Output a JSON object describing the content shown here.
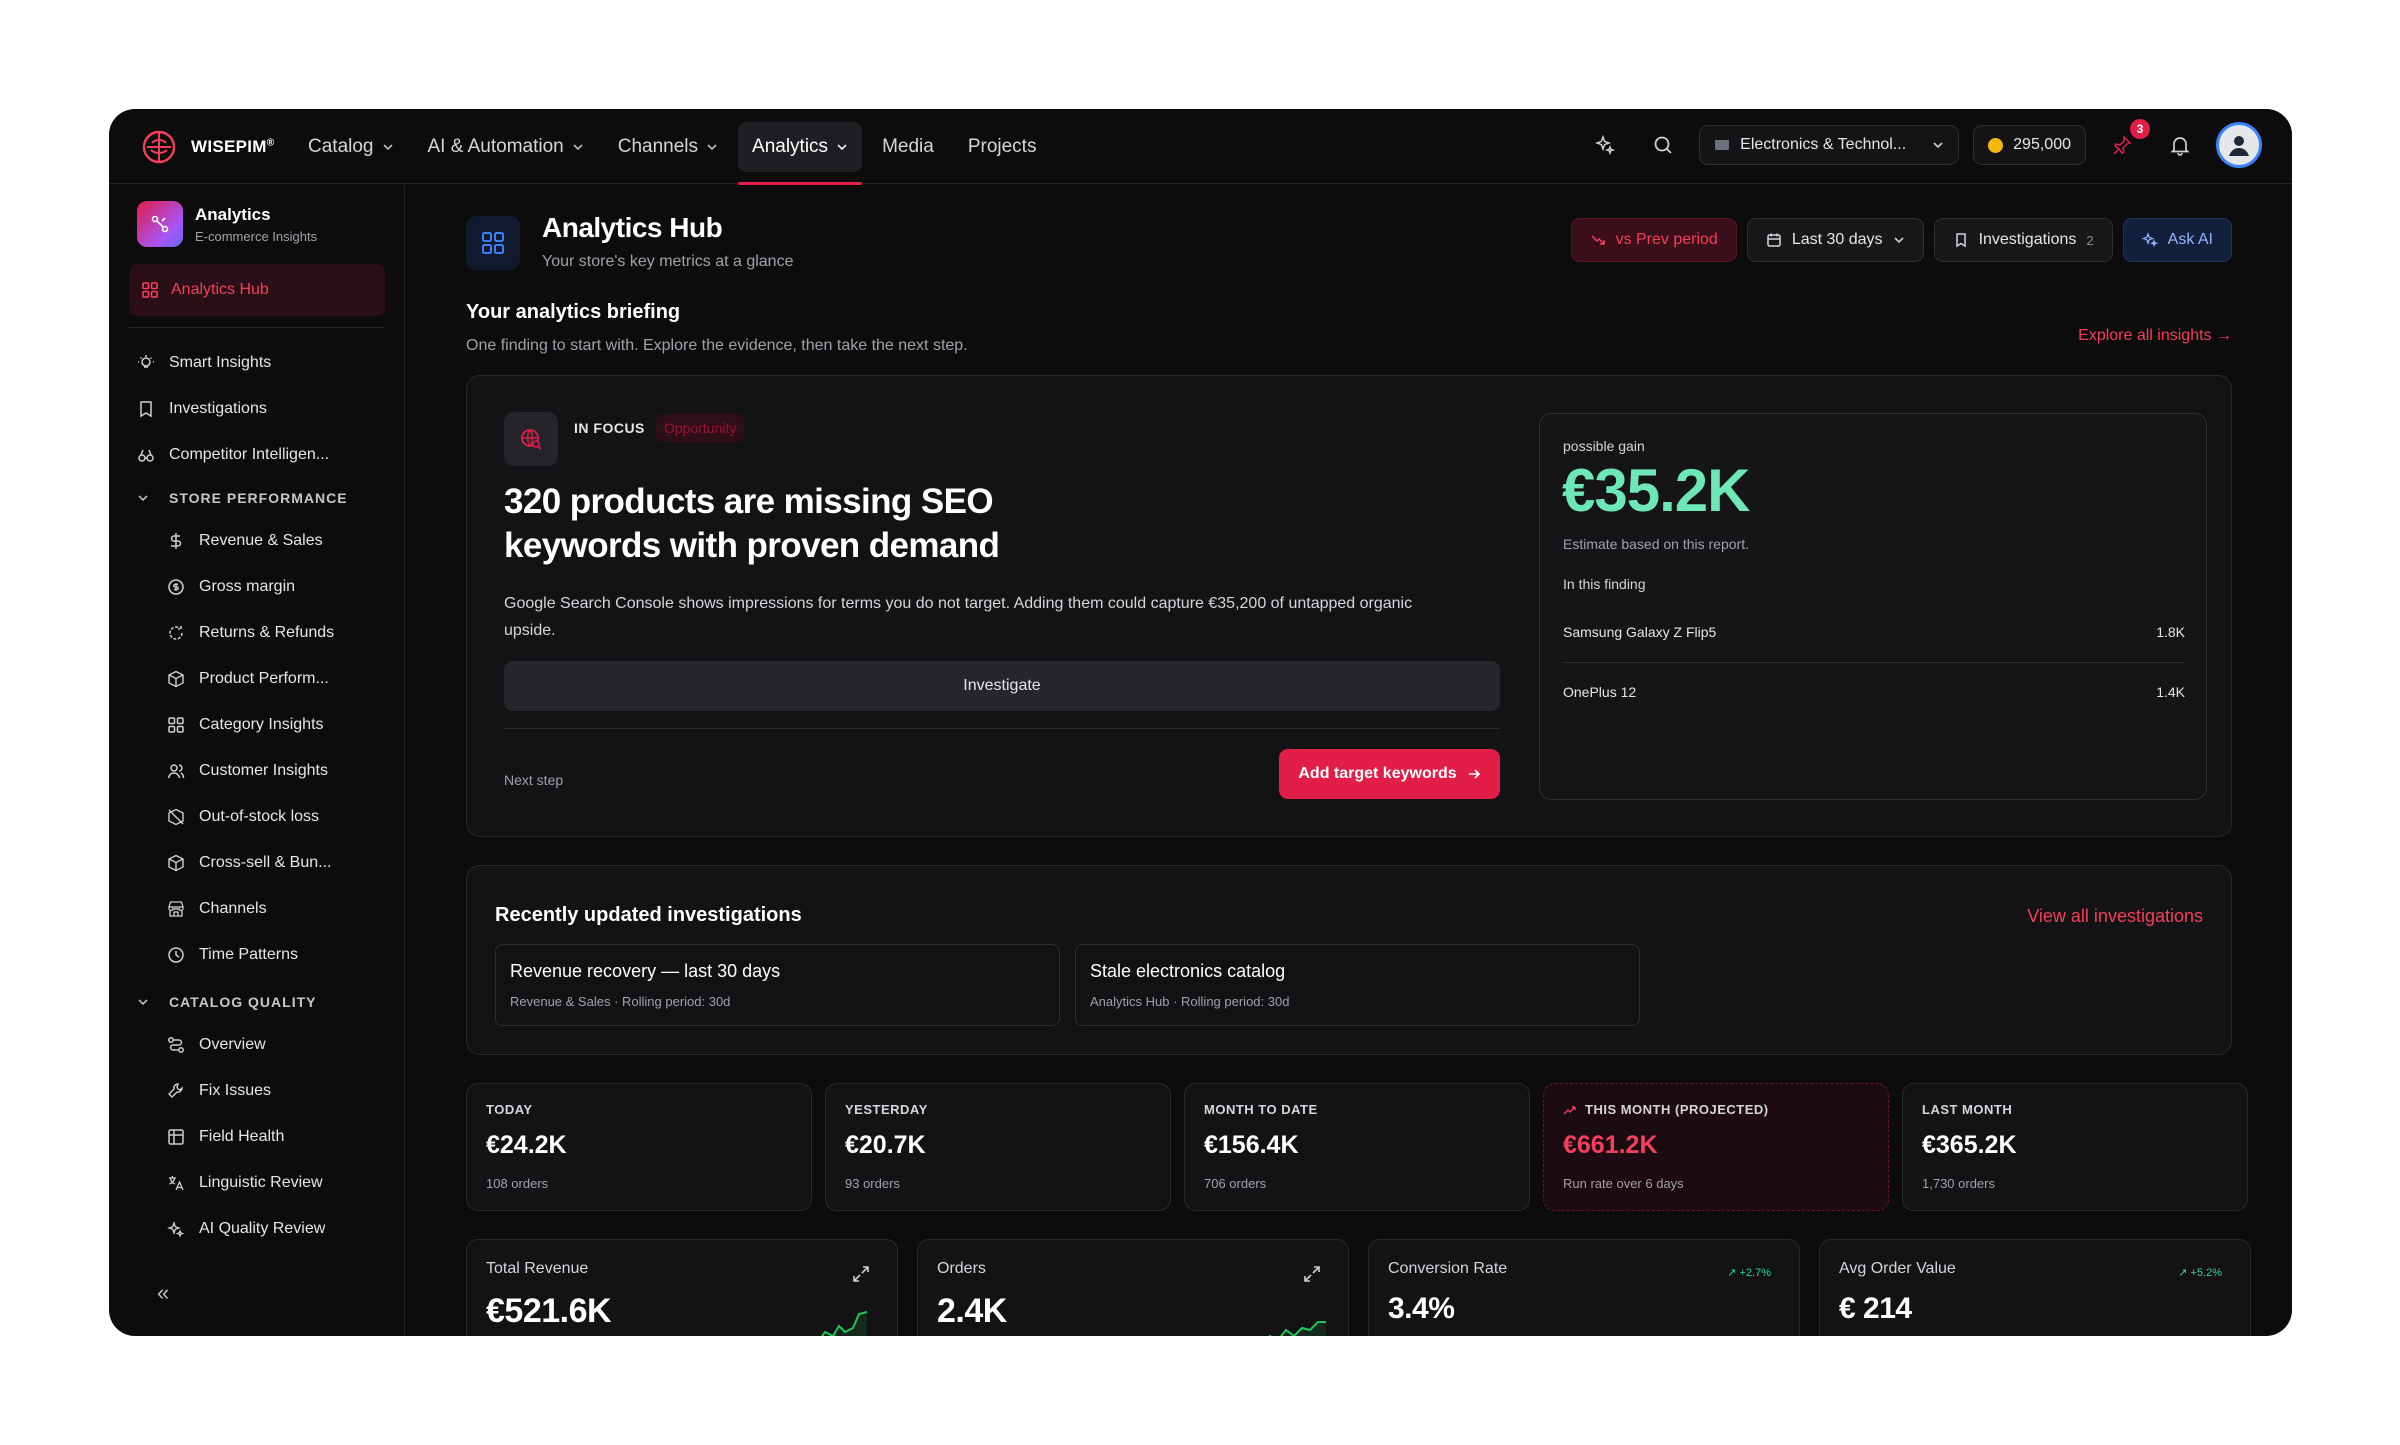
{
  "brand": {
    "name": "WISEPIM",
    "mark": "®"
  },
  "nav": {
    "items": [
      {
        "label": "Catalog",
        "dropdown": true
      },
      {
        "label": "AI & Automation",
        "dropdown": true
      },
      {
        "label": "Channels",
        "dropdown": true
      },
      {
        "label": "Analytics",
        "dropdown": true,
        "active": true
      },
      {
        "label": "Media",
        "dropdown": false
      },
      {
        "label": "Projects",
        "dropdown": false
      }
    ],
    "workspace": "Electronics & Technol...",
    "credits": "295,000",
    "notif_count": "3"
  },
  "sidebar": {
    "title": "Analytics",
    "subtitle": "E-commerce Insights",
    "active": "Analytics Hub",
    "top_items": [
      "Smart Insights",
      "Investigations",
      "Competitor Intelligen..."
    ],
    "groups": [
      {
        "label": "STORE PERFORMANCE",
        "items": [
          "Revenue & Sales",
          "Gross margin",
          "Returns & Refunds",
          "Product Perform...",
          "Category Insights",
          "Customer Insights",
          "Out-of-stock loss",
          "Cross-sell & Bun...",
          "Channels",
          "Time Patterns"
        ]
      },
      {
        "label": "CATALOG QUALITY",
        "items": [
          "Overview",
          "Fix Issues",
          "Field Health",
          "Linguistic Review",
          "AI Quality Review"
        ]
      }
    ],
    "collapse": "«"
  },
  "header": {
    "title": "Analytics Hub",
    "subtitle": "Your store's key metrics at a glance",
    "vs_prev": "vs Prev period",
    "range": "Last 30 days",
    "investigations": "Investigations",
    "investigations_count": "2",
    "ask_ai": "Ask AI"
  },
  "briefing": {
    "title": "Your analytics briefing",
    "subtitle": "One finding to start with. Explore the evidence, then take the next step.",
    "explore": "Explore all insights",
    "focus_label": "IN FOCUS",
    "focus_tag": "Opportunity",
    "headline": "320 products are missing SEO keywords with proven demand",
    "body": "Google Search Console shows impressions for terms you do not target. Adding them could capture €35,200 of untapped organic upside.",
    "investigate": "Investigate",
    "next_step": "Next step",
    "cta": "Add target keywords",
    "gain": {
      "label": "possible gain",
      "value": "€35.2K",
      "note": "Estimate based on this report.",
      "finding_label": "In this finding",
      "rows": [
        {
          "name": "Samsung Galaxy Z Flip5",
          "value": "1.8K"
        },
        {
          "name": "OnePlus 12",
          "value": "1.4K"
        }
      ]
    }
  },
  "investigations": {
    "title": "Recently updated investigations",
    "view_all": "View all investigations",
    "items": [
      {
        "title": "Revenue recovery — last 30 days",
        "meta": "Revenue & Sales · Rolling period: 30d"
      },
      {
        "title": "Stale electronics catalog",
        "meta": "Analytics Hub · Rolling period: 30d"
      }
    ]
  },
  "kpis": [
    {
      "label": "TODAY",
      "value": "€24.2K",
      "sub": "108 orders"
    },
    {
      "label": "YESTERDAY",
      "value": "€20.7K",
      "sub": "93 orders"
    },
    {
      "label": "MONTH TO DATE",
      "value": "€156.4K",
      "sub": "706 orders"
    },
    {
      "label": "THIS MONTH (PROJECTED)",
      "value": "€661.2K",
      "sub": "Run rate over 6 days"
    },
    {
      "label": "LAST MONTH",
      "value": "€365.2K",
      "sub": "1,730 orders"
    }
  ],
  "metrics": [
    {
      "label": "Total Revenue",
      "value": "€521.6K"
    },
    {
      "label": "Orders",
      "value": "2.4K"
    },
    {
      "label": "Conversion Rate",
      "value": "3.4%",
      "delta": "↗ +2.7%"
    },
    {
      "label": "Avg Order Value",
      "value": "€ 214",
      "delta": "↗ +5.2%"
    }
  ],
  "colors": {
    "accent": "#e11d48",
    "gain": "#6ee7b7",
    "positive": "#34d399",
    "bg": "#0c0c0d"
  }
}
